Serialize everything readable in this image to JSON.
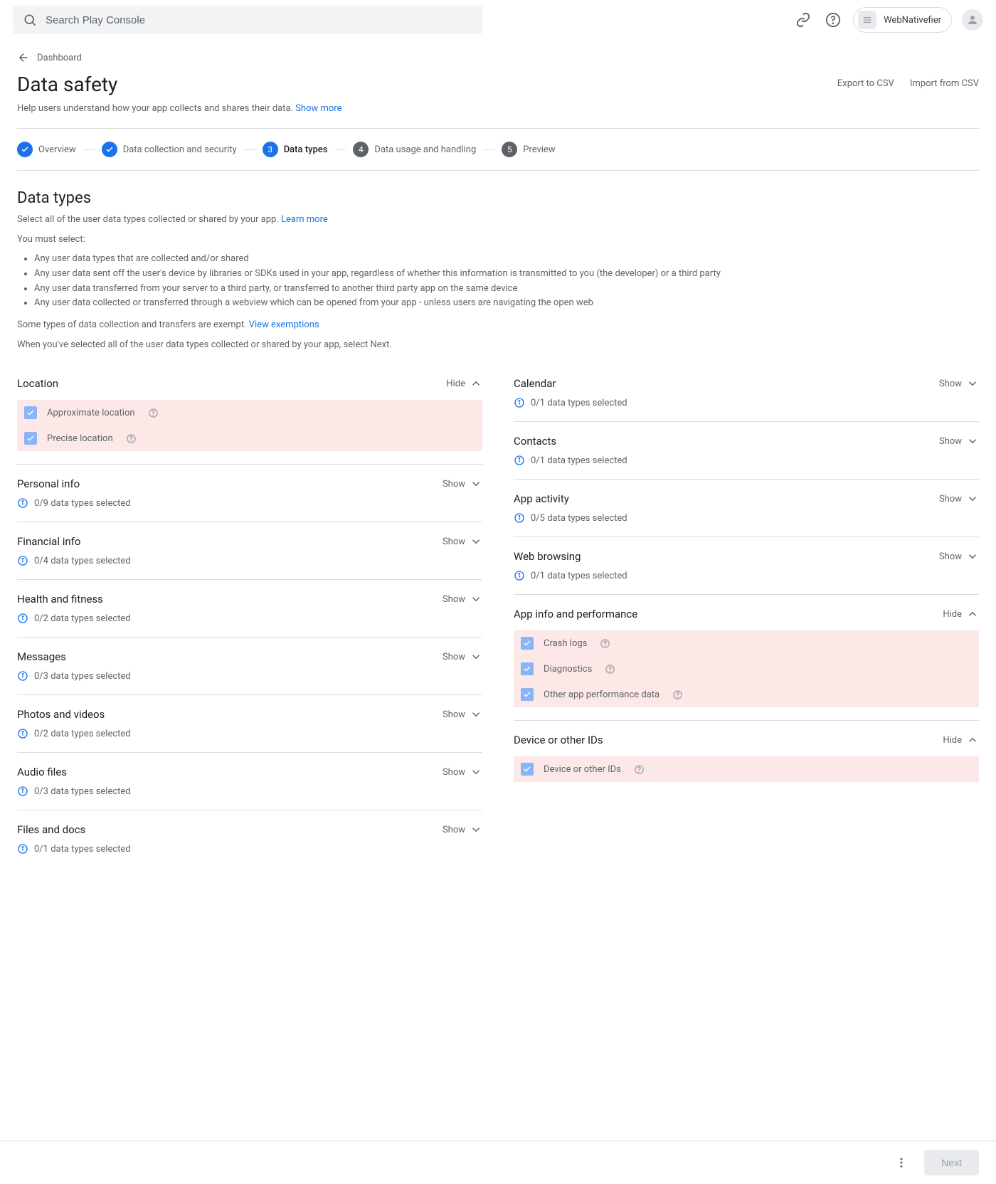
{
  "header": {
    "search_placeholder": "Search Play Console",
    "app_name": "WebNativefier"
  },
  "breadcrumb": {
    "back": "Dashboard"
  },
  "title": "Data safety",
  "title_actions": {
    "export": "Export to CSV",
    "import": "Import from CSV"
  },
  "subtitle_pre": "Help users understand how your app collects and shares their data.  ",
  "subtitle_link": "Show more",
  "stepper": [
    {
      "label": "Overview",
      "state": "done"
    },
    {
      "label": "Data collection and security",
      "state": "done"
    },
    {
      "label": "Data types",
      "state": "current",
      "num": "3"
    },
    {
      "label": "Data usage and handling",
      "state": "future",
      "num": "4"
    },
    {
      "label": "Preview",
      "state": "future",
      "num": "5"
    }
  ],
  "section_title": "Data types",
  "intro": {
    "p1a": "Select all of the user data types collected or shared by your app. ",
    "p1_link": "Learn more",
    "p2": "You must select:",
    "bullets": [
      "Any user data types that are collected and/or shared",
      "Any user data sent off the user's device by libraries or SDKs used in your app, regardless of whether this information is transmitted to you (the developer) or a third party",
      "Any user data transferred from your server to a third party, or transferred to another third party app on the same device",
      "Any user data collected or transferred through a webview which can be opened from your app - unless users are navigating the open web"
    ],
    "p3a": "Some types of data collection and transfers are exempt. ",
    "p3_link": "View exemptions",
    "p4": "When you've selected all of the user data types collected or shared by your app, select Next."
  },
  "toggle": {
    "show": "Show",
    "hide": "Hide"
  },
  "left": [
    {
      "title": "Location",
      "expanded": true,
      "items": [
        {
          "label": "Approximate location",
          "checked": true,
          "hl": true
        },
        {
          "label": "Precise location",
          "checked": true,
          "hl": true
        }
      ]
    },
    {
      "title": "Personal info",
      "status": "0/9 data types selected"
    },
    {
      "title": "Financial info",
      "status": "0/4 data types selected"
    },
    {
      "title": "Health and fitness",
      "status": "0/2 data types selected"
    },
    {
      "title": "Messages",
      "status": "0/3 data types selected"
    },
    {
      "title": "Photos and videos",
      "status": "0/2 data types selected"
    },
    {
      "title": "Audio files",
      "status": "0/3 data types selected"
    },
    {
      "title": "Files and docs",
      "status": "0/1 data types selected"
    }
  ],
  "right": [
    {
      "title": "Calendar",
      "status": "0/1 data types selected"
    },
    {
      "title": "Contacts",
      "status": "0/1 data types selected"
    },
    {
      "title": "App activity",
      "status": "0/5 data types selected"
    },
    {
      "title": "Web browsing",
      "status": "0/1 data types selected"
    },
    {
      "title": "App info and performance",
      "expanded": true,
      "items": [
        {
          "label": "Crash logs",
          "checked": true,
          "hl": true
        },
        {
          "label": "Diagnostics",
          "checked": true,
          "hl": true
        },
        {
          "label": "Other app performance data",
          "checked": true,
          "hl": true
        }
      ]
    },
    {
      "title": "Device or other IDs",
      "expanded": true,
      "items": [
        {
          "label": "Device or other IDs",
          "checked": true,
          "hl": true
        }
      ]
    }
  ],
  "footer": {
    "next": "Next"
  }
}
